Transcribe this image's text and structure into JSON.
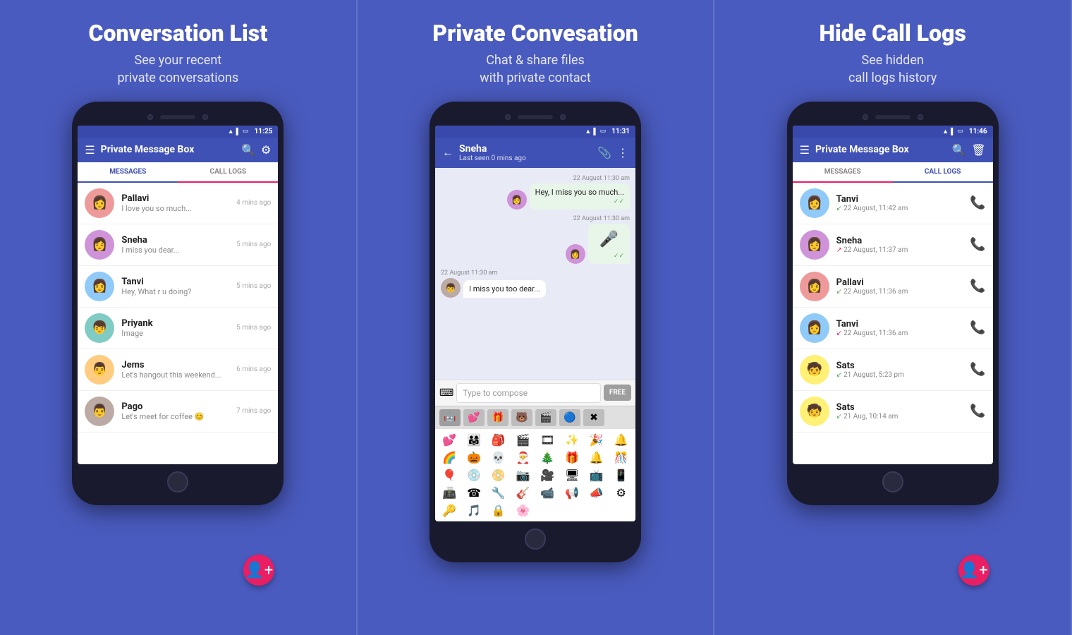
{
  "panel1": {
    "title": "Conversation List",
    "subtitle": "See your recent\nprivate conversations",
    "status_time": "11:25",
    "app_title": "Private Message Box",
    "tabs": [
      "MESSAGES",
      "CALL LOGS"
    ],
    "conversations": [
      {
        "name": "Pallavi",
        "preview": "I love you so much...",
        "time": "4 mins ago",
        "avatar": "👩",
        "av_class": "av-red"
      },
      {
        "name": "Sneha",
        "preview": "I miss you dear...",
        "time": "5 mins ago",
        "avatar": "👩",
        "av_class": "av-purple"
      },
      {
        "name": "Tanvi",
        "preview": "Hey, What r u doing?",
        "time": "5 mins ago",
        "avatar": "👩",
        "av_class": "av-blue"
      },
      {
        "name": "Priyank",
        "preview": "Image",
        "time": "5 mins ago",
        "avatar": "👦",
        "av_class": "av-teal"
      },
      {
        "name": "Jems",
        "preview": "Let's hangout this weekend...",
        "time": "6 mins ago",
        "avatar": "👨",
        "av_class": "av-orange"
      },
      {
        "name": "Pago",
        "preview": "Let's meet for coffee 😊",
        "time": "7 mins ago",
        "avatar": "👨",
        "av_class": "av-brown"
      }
    ]
  },
  "panel2": {
    "title": "Private Convesation",
    "subtitle": "Chat & share files\nwith private contact",
    "status_time": "11:31",
    "contact_name": "Sneha",
    "contact_status": "Last seen 0 mins ago",
    "messages": [
      {
        "side": "right",
        "time": "22 August 11:30 am",
        "text": "Hey, I miss you so much...",
        "checked": true
      },
      {
        "side": "right",
        "time": "22 August 11:30 am",
        "text": "🎤",
        "is_voice": true,
        "checked": true
      },
      {
        "side": "left",
        "time": "22 August 11:30 am",
        "text": "I miss you too dear..."
      }
    ],
    "compose_placeholder": "Type to compose",
    "compose_btn": "FREE",
    "emoji_tabs": [
      "🤖",
      "💕",
      "🎁",
      "🐻",
      "🎬",
      "🔵",
      "✖"
    ],
    "emojis": [
      "💕",
      "👨‍👩‍👧",
      "🎒",
      "🎬",
      "🎞",
      "✨",
      "🎉",
      "🔔",
      "🌈",
      "🎃",
      "💀",
      "🎅",
      "🎄",
      "🎁",
      "🔔",
      "🎊",
      "🎈",
      "💿",
      "📀",
      "📷",
      "🎥",
      "🖥",
      "📺",
      "📱",
      "📠",
      "☎",
      "🔧",
      "🎸",
      "📹",
      "📢",
      "📣",
      "⚙",
      "🔑",
      "🎵",
      "🔒",
      "🌸"
    ]
  },
  "panel3": {
    "title": "Hide Call Logs",
    "subtitle": "See hidden\ncall logs history",
    "status_time": "11:46",
    "app_title": "Private Message Box",
    "tabs": [
      "MESSAGES",
      "CALL LOGS"
    ],
    "calls": [
      {
        "name": "Tanvi",
        "time": "22 August, 11:42 am",
        "type": "in",
        "avatar": "👩",
        "av_class": "av-blue"
      },
      {
        "name": "Sneha",
        "time": "22 August, 11:37 am",
        "type": "out",
        "avatar": "👩",
        "av_class": "av-purple"
      },
      {
        "name": "Pallavi",
        "time": "22 August, 11:36 am",
        "type": "in",
        "avatar": "👩",
        "av_class": "av-red"
      },
      {
        "name": "Tanvi",
        "time": "22 August, 11:36 am",
        "type": "missed",
        "avatar": "👩",
        "av_class": "av-blue"
      },
      {
        "name": "Sats",
        "time": "21 August, 5:23 pm",
        "type": "in",
        "avatar": "🧒",
        "av_class": "av-yellow"
      },
      {
        "name": "Sats",
        "time": "21 Aug, 10:14 am",
        "type": "in",
        "avatar": "🧒",
        "av_class": "av-yellow"
      }
    ],
    "call_type_symbols": {
      "in": "↙",
      "out": "↗",
      "missed": "↙"
    }
  }
}
